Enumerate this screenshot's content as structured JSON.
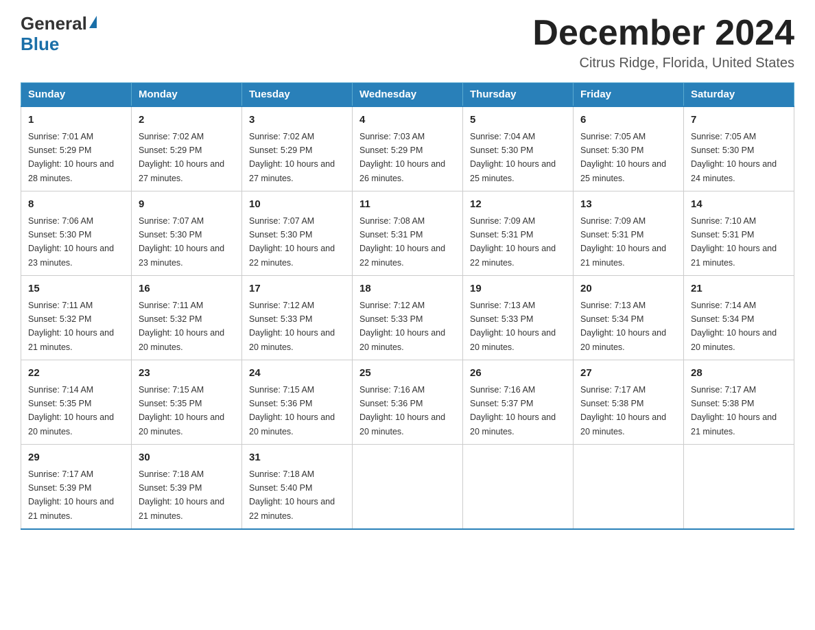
{
  "header": {
    "logo_general": "General",
    "logo_blue": "Blue",
    "month_title": "December 2024",
    "subtitle": "Citrus Ridge, Florida, United States"
  },
  "days_of_week": [
    "Sunday",
    "Monday",
    "Tuesday",
    "Wednesday",
    "Thursday",
    "Friday",
    "Saturday"
  ],
  "weeks": [
    [
      {
        "day": "1",
        "sunrise": "7:01 AM",
        "sunset": "5:29 PM",
        "daylight": "10 hours and 28 minutes."
      },
      {
        "day": "2",
        "sunrise": "7:02 AM",
        "sunset": "5:29 PM",
        "daylight": "10 hours and 27 minutes."
      },
      {
        "day": "3",
        "sunrise": "7:02 AM",
        "sunset": "5:29 PM",
        "daylight": "10 hours and 27 minutes."
      },
      {
        "day": "4",
        "sunrise": "7:03 AM",
        "sunset": "5:29 PM",
        "daylight": "10 hours and 26 minutes."
      },
      {
        "day": "5",
        "sunrise": "7:04 AM",
        "sunset": "5:30 PM",
        "daylight": "10 hours and 25 minutes."
      },
      {
        "day": "6",
        "sunrise": "7:05 AM",
        "sunset": "5:30 PM",
        "daylight": "10 hours and 25 minutes."
      },
      {
        "day": "7",
        "sunrise": "7:05 AM",
        "sunset": "5:30 PM",
        "daylight": "10 hours and 24 minutes."
      }
    ],
    [
      {
        "day": "8",
        "sunrise": "7:06 AM",
        "sunset": "5:30 PM",
        "daylight": "10 hours and 23 minutes."
      },
      {
        "day": "9",
        "sunrise": "7:07 AM",
        "sunset": "5:30 PM",
        "daylight": "10 hours and 23 minutes."
      },
      {
        "day": "10",
        "sunrise": "7:07 AM",
        "sunset": "5:30 PM",
        "daylight": "10 hours and 22 minutes."
      },
      {
        "day": "11",
        "sunrise": "7:08 AM",
        "sunset": "5:31 PM",
        "daylight": "10 hours and 22 minutes."
      },
      {
        "day": "12",
        "sunrise": "7:09 AM",
        "sunset": "5:31 PM",
        "daylight": "10 hours and 22 minutes."
      },
      {
        "day": "13",
        "sunrise": "7:09 AM",
        "sunset": "5:31 PM",
        "daylight": "10 hours and 21 minutes."
      },
      {
        "day": "14",
        "sunrise": "7:10 AM",
        "sunset": "5:31 PM",
        "daylight": "10 hours and 21 minutes."
      }
    ],
    [
      {
        "day": "15",
        "sunrise": "7:11 AM",
        "sunset": "5:32 PM",
        "daylight": "10 hours and 21 minutes."
      },
      {
        "day": "16",
        "sunrise": "7:11 AM",
        "sunset": "5:32 PM",
        "daylight": "10 hours and 20 minutes."
      },
      {
        "day": "17",
        "sunrise": "7:12 AM",
        "sunset": "5:33 PM",
        "daylight": "10 hours and 20 minutes."
      },
      {
        "day": "18",
        "sunrise": "7:12 AM",
        "sunset": "5:33 PM",
        "daylight": "10 hours and 20 minutes."
      },
      {
        "day": "19",
        "sunrise": "7:13 AM",
        "sunset": "5:33 PM",
        "daylight": "10 hours and 20 minutes."
      },
      {
        "day": "20",
        "sunrise": "7:13 AM",
        "sunset": "5:34 PM",
        "daylight": "10 hours and 20 minutes."
      },
      {
        "day": "21",
        "sunrise": "7:14 AM",
        "sunset": "5:34 PM",
        "daylight": "10 hours and 20 minutes."
      }
    ],
    [
      {
        "day": "22",
        "sunrise": "7:14 AM",
        "sunset": "5:35 PM",
        "daylight": "10 hours and 20 minutes."
      },
      {
        "day": "23",
        "sunrise": "7:15 AM",
        "sunset": "5:35 PM",
        "daylight": "10 hours and 20 minutes."
      },
      {
        "day": "24",
        "sunrise": "7:15 AM",
        "sunset": "5:36 PM",
        "daylight": "10 hours and 20 minutes."
      },
      {
        "day": "25",
        "sunrise": "7:16 AM",
        "sunset": "5:36 PM",
        "daylight": "10 hours and 20 minutes."
      },
      {
        "day": "26",
        "sunrise": "7:16 AM",
        "sunset": "5:37 PM",
        "daylight": "10 hours and 20 minutes."
      },
      {
        "day": "27",
        "sunrise": "7:17 AM",
        "sunset": "5:38 PM",
        "daylight": "10 hours and 20 minutes."
      },
      {
        "day": "28",
        "sunrise": "7:17 AM",
        "sunset": "5:38 PM",
        "daylight": "10 hours and 21 minutes."
      }
    ],
    [
      {
        "day": "29",
        "sunrise": "7:17 AM",
        "sunset": "5:39 PM",
        "daylight": "10 hours and 21 minutes."
      },
      {
        "day": "30",
        "sunrise": "7:18 AM",
        "sunset": "5:39 PM",
        "daylight": "10 hours and 21 minutes."
      },
      {
        "day": "31",
        "sunrise": "7:18 AM",
        "sunset": "5:40 PM",
        "daylight": "10 hours and 22 minutes."
      },
      null,
      null,
      null,
      null
    ]
  ],
  "labels": {
    "sunrise_prefix": "Sunrise: ",
    "sunset_prefix": "Sunset: ",
    "daylight_prefix": "Daylight: "
  }
}
